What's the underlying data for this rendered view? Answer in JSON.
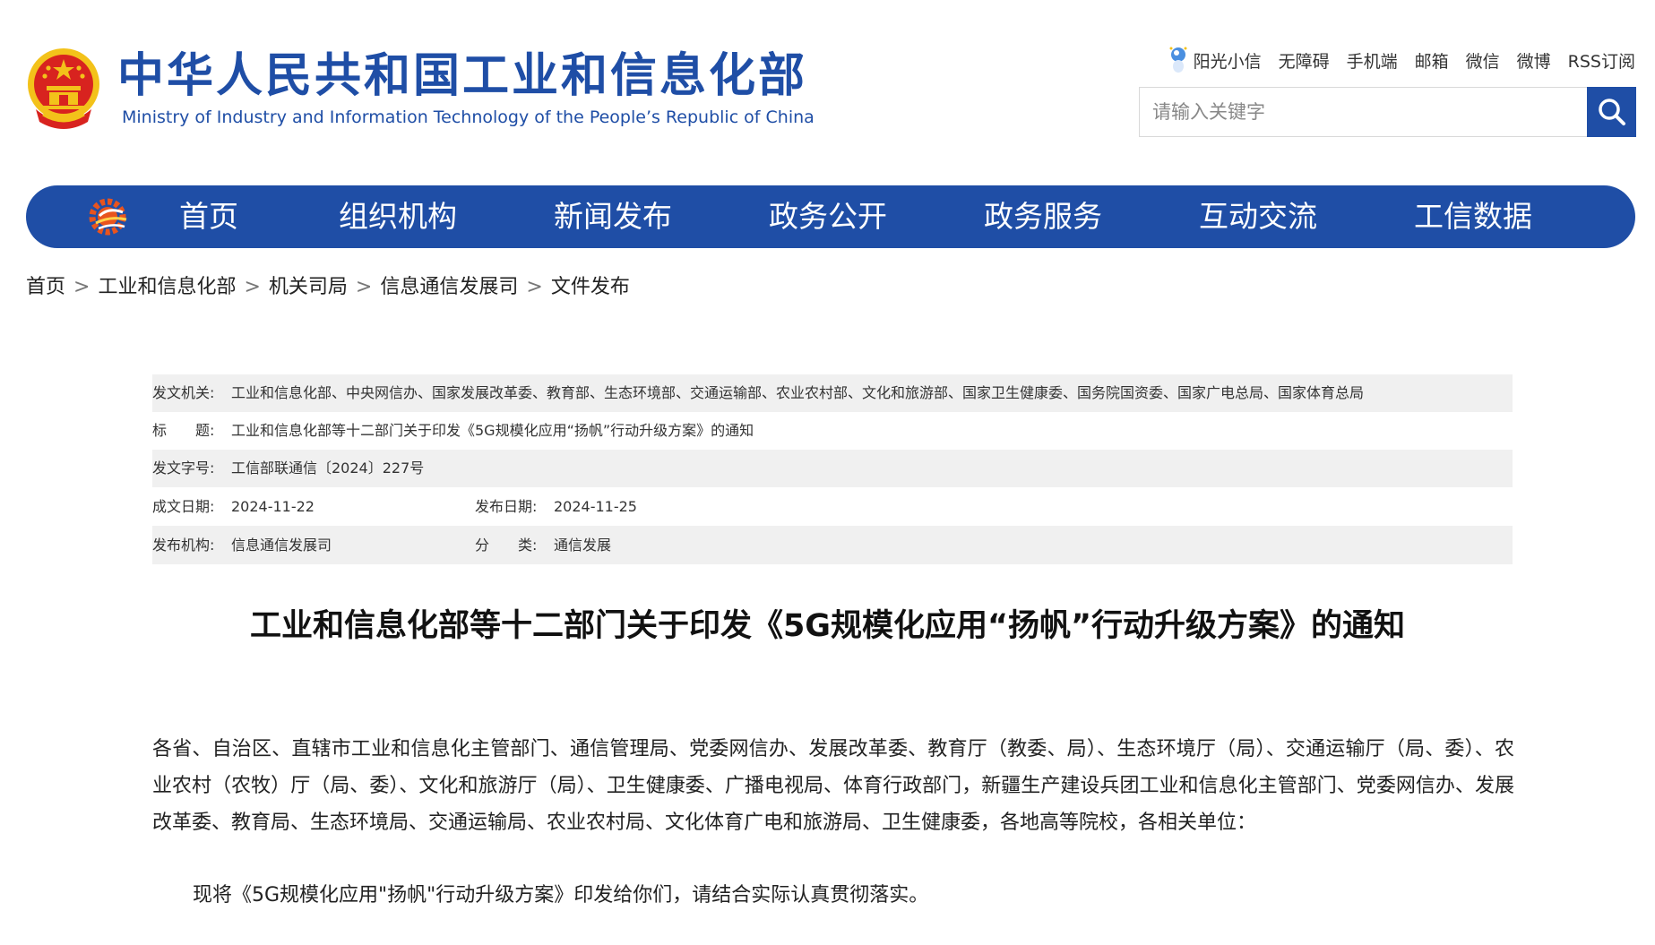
{
  "header": {
    "title_cn": "中华人民共和国工业和信息化部",
    "title_en": "Ministry of Industry and Information Technology of the People’s Republic of China",
    "emblem_icon": "national-emblem-icon",
    "top_links": [
      "阳光小信",
      "无障碍",
      "手机端",
      "邮箱",
      "微信",
      "微博",
      "RSS订阅"
    ],
    "search": {
      "placeholder": "请输入关键字",
      "value": "",
      "button_icon": "search-icon"
    }
  },
  "nav": {
    "logo_icon": "gear-logo-icon",
    "items": [
      "首页",
      "组织机构",
      "新闻发布",
      "政务公开",
      "政务服务",
      "互动交流",
      "工信数据"
    ]
  },
  "breadcrumb": [
    "首页",
    "工业和信息化部",
    "机关司局",
    "信息通信发展司",
    "文件发布"
  ],
  "breadcrumb_separator": ">",
  "meta": {
    "issuer_label": "发文机关:",
    "issuer": "工业和信息化部、中央网信办、国家发展改革委、教育部、生态环境部、交通运输部、农业农村部、文化和旅游部、国家卫生健康委、国务院国资委、国家广电总局、国家体育总局",
    "title_label": "标　　题:",
    "title": "工业和信息化部等十二部门关于印发《5G规模化应用“扬帆”行动升级方案》的通知",
    "doc_no_label": "发文字号:",
    "doc_no": "工信部联通信〔2024〕227号",
    "created_label": "成文日期:",
    "created": "2024-11-22",
    "published_label": "发布日期:",
    "published": "2024-11-25",
    "org_label": "发布机构:",
    "org": "信息通信发展司",
    "category_label": "分　　类:",
    "category": "通信发展"
  },
  "article": {
    "title": "工业和信息化部等十二部门关于印发《5G规模化应用“扬帆”行动升级方案》的通知",
    "para1": "各省、自治区、直辖市工业和信息化主管部门、通信管理局、党委网信办、发展改革委、教育厅（教委、局）、生态环境厅（局）、交通运输厅（局、委）、农业农村（农牧）厅（局、委）、文化和旅游厅（局）、卫生健康委、广播电视局、体育行政部门，新疆生产建设兵团工业和信息化主管部门、党委网信办、发展改革委、教育局、生态环境局、交通运输局、农业农村局、文化体育广电和旅游局、卫生健康委，各地高等院校，各相关单位：",
    "para2": "现将《5G规模化应用\"扬帆\"行动升级方案》印发给你们，请结合实际认真贯彻落实。"
  },
  "colors": {
    "brand_blue": "#1f4ea6",
    "meta_shade": "#f0f0f0",
    "emblem_red": "#d8231f",
    "emblem_gold": "#f3c21a"
  }
}
